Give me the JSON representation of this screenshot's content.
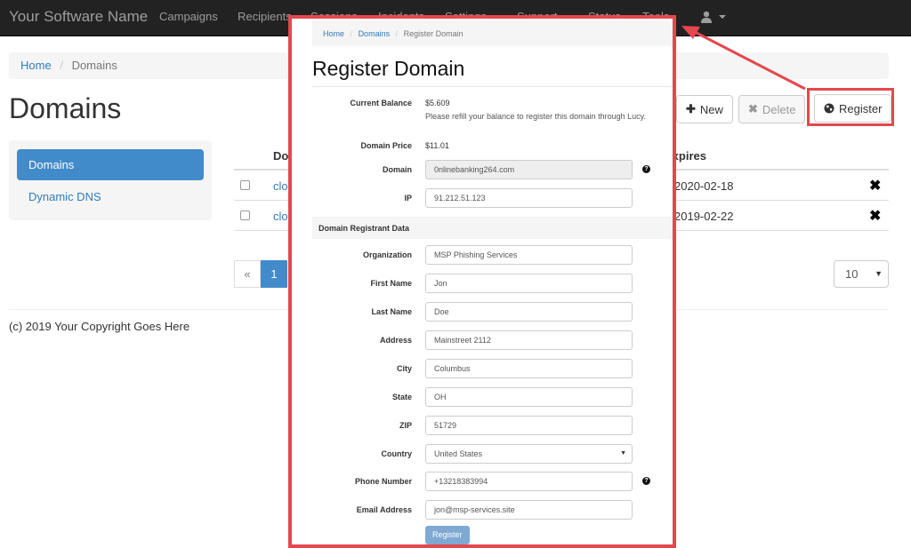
{
  "navbar": {
    "brand": "Your Software Name",
    "items": [
      "Campaigns",
      "Recipients",
      "Sessions",
      "Incidents",
      "Settings",
      "Support",
      "Status",
      "Tools"
    ]
  },
  "page": {
    "breadcrumb": {
      "home": "Home",
      "current": "Domains"
    },
    "title": "Domains",
    "buttons": {
      "new": "New",
      "delete": "Delete",
      "register": "Register"
    },
    "sidebar": [
      "Domains",
      "Dynamic DNS"
    ],
    "table": {
      "header_domain": "Domain",
      "header_expires": "Expires",
      "rows": [
        {
          "name": "cloud",
          "expires": "2020-02-18"
        },
        {
          "name": "cloud",
          "expires": "2019-02-22"
        }
      ]
    },
    "pagination": {
      "prev": "«",
      "current": "1"
    },
    "page_size": "10",
    "footer": "(c) 2019 Your Copyright Goes Here"
  },
  "modal": {
    "breadcrumb": {
      "home": "Home",
      "domains": "Domains",
      "current": "Register Domain"
    },
    "title": "Register Domain",
    "current_balance_label": "Current Balance",
    "current_balance_value": "$5.609",
    "balance_note": "Please refill your balance to register this domain through Lucy.",
    "domain_price_label": "Domain Price",
    "domain_price_value": "$11.01",
    "domain_label": "Domain",
    "domain_value": "0nlinebanking264.com",
    "ip_label": "IP",
    "ip_value": "91.212.51.123",
    "section_title": "Domain Registrant Data",
    "fields": {
      "organization": {
        "label": "Organization",
        "value": "MSP Phishing Services"
      },
      "first_name": {
        "label": "First Name",
        "value": "Jon"
      },
      "last_name": {
        "label": "Last Name",
        "value": "Doe"
      },
      "address": {
        "label": "Address",
        "value": "Mainstreet 2112"
      },
      "city": {
        "label": "City",
        "value": "Columbus"
      },
      "state": {
        "label": "State",
        "value": "OH"
      },
      "zip": {
        "label": "ZIP",
        "value": "51729"
      },
      "country": {
        "label": "Country",
        "value": "United States"
      },
      "phone": {
        "label": "Phone Number",
        "value": "+13218383994"
      },
      "email": {
        "label": "Email Address",
        "value": "jon@msp-services.site"
      }
    },
    "submit_label": "Register"
  },
  "colors": {
    "navbar_bg": "#222222",
    "primary": "#428bca",
    "link": "#337ab7",
    "annotation_red": "#e5474f"
  }
}
